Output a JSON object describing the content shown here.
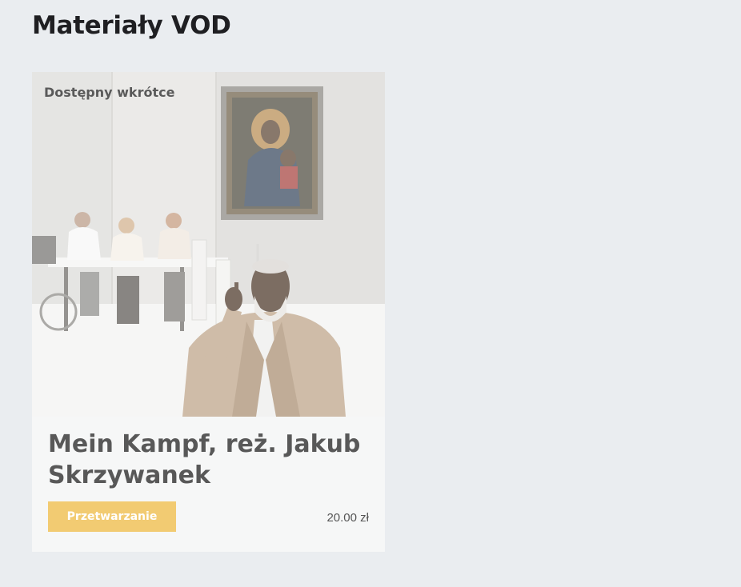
{
  "page": {
    "title": "Materiały VOD"
  },
  "vod_item": {
    "badge": "Dostępny wkrótce",
    "title": "Mein Kampf, reż. Jakub Skrzywanek",
    "status_button_label": "Przetwarzanie",
    "price": "20.00 zł",
    "image_alt": "Mein Kampf, reż. Jakub Skrzywanek"
  },
  "colors": {
    "background": "#eaedf0",
    "card": "#f6f7f7",
    "button": "#f2cb72",
    "title_text": "#1f1f22",
    "card_text": "#585858"
  }
}
